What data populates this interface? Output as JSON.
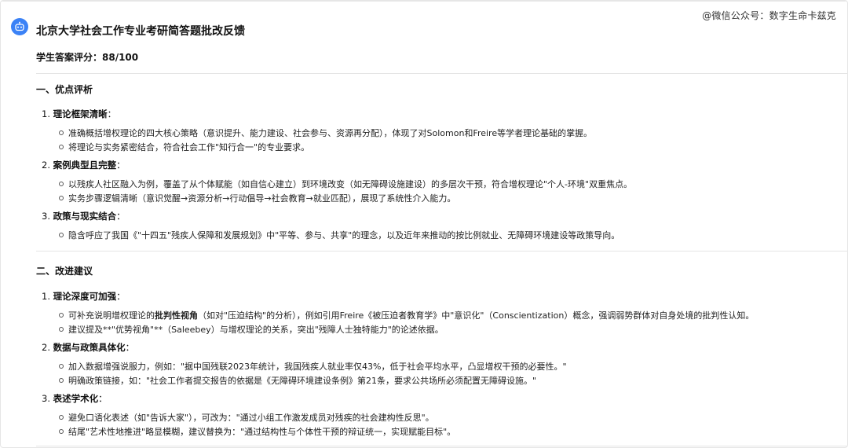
{
  "header": {
    "title": "北京大学社会工作专业考研简答题批改反馈",
    "watermark": "@微信公众号：数字生命卡兹克",
    "score_label": "学生答案评分：88/100"
  },
  "section1": {
    "heading": "一、优点评析",
    "items": [
      {
        "label": "1. ",
        "title": "理论框架清晰",
        "suffix": "：",
        "bullets": [
          "准确概括增权理论的四大核心策略（意识提升、能力建设、社会参与、资源再分配），体现了对Solomon和Freire等学者理论基础的掌握。",
          "将理论与实务紧密结合，符合社会工作\"知行合一\"的专业要求。"
        ]
      },
      {
        "label": "2. ",
        "title": "案例典型且完整",
        "suffix": "：",
        "bullets": [
          "以残疾人社区融入为例，覆盖了从个体赋能（如自信心建立）到环境改变（如无障碍设施建设）的多层次干预，符合增权理论\"个人-环境\"双重焦点。",
          "实务步骤逻辑清晰（意识觉醒→资源分析→行动倡导→社会教育→就业匹配），展现了系统性介入能力。"
        ]
      },
      {
        "label": "3. ",
        "title": "政策与现实结合",
        "suffix": "：",
        "bullets": [
          "隐含呼应了我国《\"十四五\"残疾人保障和发展规划》中\"平等、参与、共享\"的理念，以及近年来推动的按比例就业、无障碍环境建设等政策导向。"
        ]
      }
    ]
  },
  "section2": {
    "heading": "二、改进建议",
    "items": [
      {
        "label": "1. ",
        "title": "理论深度可加强",
        "suffix": "：",
        "bullets": [
          {
            "pre": "可补充说明增权理论的",
            "bold": "批判性视角",
            "post": "（如对\"压迫结构\"的分析），例如引用Freire《被压迫者教育学》中\"意识化\"（Conscientization）概念，强调弱势群体对自身处境的批判性认知。"
          },
          {
            "pre": "建议提及**\"优势视角\"**（Saleebey）与增权理论的关系，突出\"残障人士独特能力\"的论述依据。",
            "bold": "",
            "post": ""
          }
        ]
      },
      {
        "label": "2. ",
        "title": "数据与政策具体化",
        "suffix": "：",
        "bullets": [
          {
            "pre": "加入数据增强说服力，例如：\"据中国残联2023年统计，我国残疾人就业率仅43%，低于社会平均水平，凸显增权干预的必要性。\"",
            "bold": "",
            "post": ""
          },
          {
            "pre": "明确政策链接，如：\"社会工作者提交报告的依据是《无障碍环境建设条例》第21条，要求公共场所必须配置无障碍设施。\"",
            "bold": "",
            "post": ""
          }
        ]
      },
      {
        "label": "3. ",
        "title": "表述学术化",
        "suffix": "：",
        "bullets": [
          {
            "pre": "避免口语化表述（如\"告诉大家\"），可改为：\"通过小组工作激发成员对残疾的社会建构性反思\"。",
            "bold": "",
            "post": ""
          },
          {
            "pre": "结尾\"艺术性地推进\"略显模糊，建议替换为：\"通过结构性与个体性干预的辩证统一，实现赋能目标\"。",
            "bold": "",
            "post": ""
          }
        ]
      }
    ]
  },
  "colors": {
    "avatar": "#3b82f6",
    "text": "#1f1f1f",
    "divider": "#e5e5e5"
  },
  "icons": {
    "avatar": "bot-avatar-icon"
  }
}
